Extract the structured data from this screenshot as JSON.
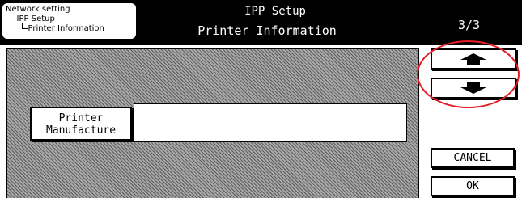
{
  "breadcrumb": {
    "items": [
      "Network setting",
      "IPP Setup",
      "Printer Information"
    ]
  },
  "header": {
    "title": "IPP Setup",
    "subtitle": "Printer Information",
    "page": "3/3"
  },
  "field": {
    "label_line1": "Printer",
    "label_line2": "Manufacture",
    "value": ""
  },
  "buttons": {
    "up_icon": "arrow-up-icon",
    "down_icon": "arrow-down-icon",
    "cancel": "CANCEL",
    "ok": "OK"
  },
  "colors": {
    "header_bg": "#000000",
    "annotation": "#e41e26",
    "panel_hatch": "#7a7a7a"
  }
}
